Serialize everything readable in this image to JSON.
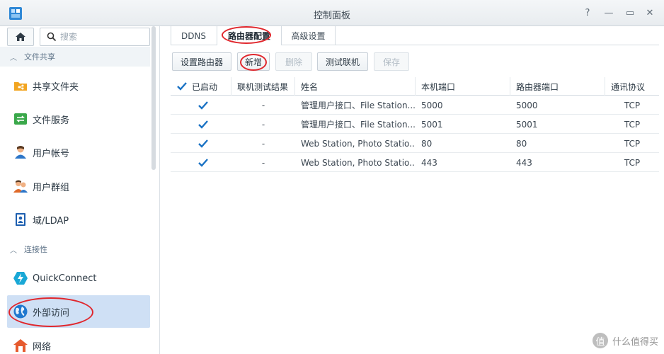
{
  "window": {
    "title": "控制面板",
    "controls": {
      "help": "?",
      "minimize": "—",
      "maximize": "▭",
      "close": "✕"
    }
  },
  "sidebar": {
    "search_placeholder": "搜索",
    "sections": {
      "file_sharing": "文件共享",
      "connectivity": "连接性"
    },
    "items": [
      {
        "label": "共享文件夹",
        "icon": "shared-folder-icon"
      },
      {
        "label": "文件服务",
        "icon": "file-services-icon"
      },
      {
        "label": "用户帐号",
        "icon": "user-icon"
      },
      {
        "label": "用户群组",
        "icon": "group-icon"
      },
      {
        "label": "域/LDAP",
        "icon": "domain-ldap-icon"
      },
      {
        "label": "QuickConnect",
        "icon": "quickconnect-icon"
      },
      {
        "label": "外部访问",
        "icon": "globe-icon",
        "active": true
      },
      {
        "label": "网络",
        "icon": "network-house-icon"
      }
    ]
  },
  "tabs": [
    {
      "label": "DDNS"
    },
    {
      "label": "路由器配置",
      "active": true
    },
    {
      "label": "高级设置"
    }
  ],
  "toolbar": {
    "setup_router": "设置路由器",
    "create": "新增",
    "delete": "删除",
    "test_connection": "测试联机",
    "save": "保存"
  },
  "table": {
    "headers": {
      "enabled": "已启动",
      "test_result": "联机测试结果",
      "name": "姓名",
      "local_port": "本机端口",
      "router_port": "路由器端口",
      "protocol": "通讯协议"
    },
    "rows": [
      {
        "enabled": true,
        "test_result": "-",
        "name": "管理用户接口、File Station...",
        "local_port": "5000",
        "router_port": "5000",
        "protocol": "TCP"
      },
      {
        "enabled": true,
        "test_result": "-",
        "name": "管理用户接口、File Station...",
        "local_port": "5001",
        "router_port": "5001",
        "protocol": "TCP"
      },
      {
        "enabled": true,
        "test_result": "-",
        "name": "Web Station, Photo Statio...",
        "local_port": "80",
        "router_port": "80",
        "protocol": "TCP"
      },
      {
        "enabled": true,
        "test_result": "-",
        "name": "Web Station, Photo Statio...",
        "local_port": "443",
        "router_port": "443",
        "protocol": "TCP"
      }
    ]
  },
  "colors": {
    "accent": "#1a72c4",
    "active_nav": "#cfe0f5",
    "annotation": "#e0262c"
  },
  "watermark": {
    "text": "什么值得买",
    "logo": "值"
  }
}
